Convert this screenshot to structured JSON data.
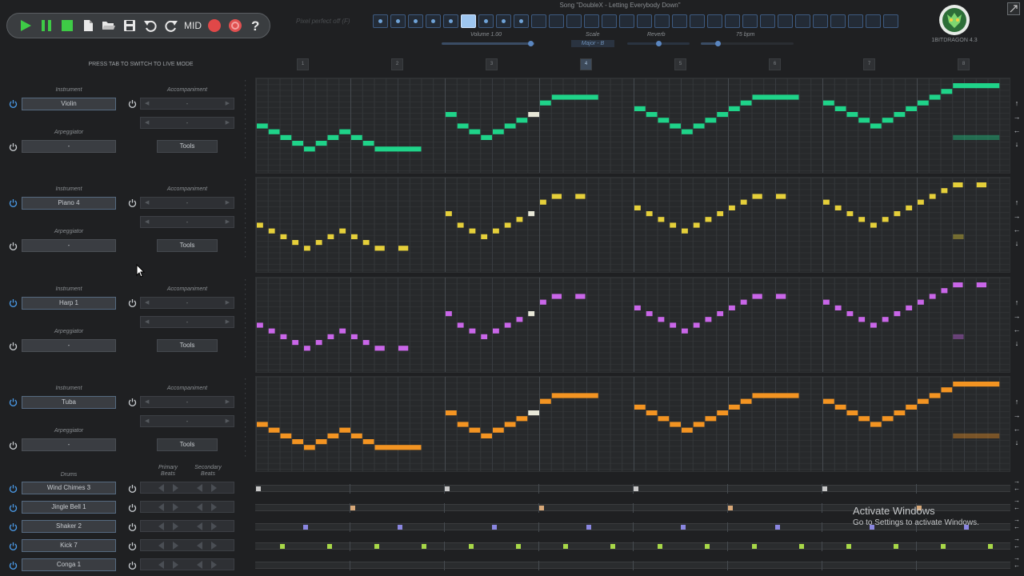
{
  "toolbar": {
    "buttons": [
      {
        "name": "play-button",
        "icon": "play-icon",
        "color": "#3ecb46"
      },
      {
        "name": "pause-button",
        "icon": "pause-icon",
        "color": "#3ecb46"
      },
      {
        "name": "stop-button",
        "icon": "stop-icon",
        "color": "#3ecb46"
      },
      {
        "name": "new-file-button",
        "icon": "new-file-icon",
        "color": "#e8e8e8"
      },
      {
        "name": "open-folder-button",
        "icon": "folder-open-icon",
        "color": "#e8e8e8"
      },
      {
        "name": "save-button",
        "icon": "save-icon",
        "color": "#e8e8e8"
      },
      {
        "name": "undo-button",
        "icon": "undo-icon",
        "color": "#e8e8e8"
      },
      {
        "name": "redo-button",
        "icon": "redo-icon",
        "color": "#e8e8e8"
      }
    ],
    "mid_label": "MID",
    "record_color": "#e04848",
    "loop_color": "#e05050"
  },
  "header": {
    "song_title": "Song \"DoubleX - Letting Everybody Down\"",
    "hint": "Pixel perfect off (F)",
    "volume_label": "Volume 1.00",
    "scale_label": "Scale",
    "scale_value": "Major - B",
    "reverb_label": "Reverb",
    "bpm_label": "75 bpm",
    "version": "1BITDRAGON 4.3",
    "live_hint": "PRESS TAB TO SWITCH TO LIVE MODE"
  },
  "patterns": {
    "filled": [
      true,
      true,
      true,
      true,
      true,
      "sel",
      true,
      true,
      true,
      false,
      false,
      false,
      false,
      false,
      false,
      false,
      false,
      false,
      false,
      false,
      false,
      false,
      false,
      false,
      false,
      false,
      false,
      false,
      false,
      false
    ]
  },
  "bars": {
    "labels": [
      "1",
      "2",
      "3",
      "4",
      "5",
      "6",
      "7",
      "8"
    ],
    "current": "4"
  },
  "tracks": [
    {
      "instrument_label": "Instrument",
      "instrument": "Violin",
      "accompaniment_label": "Accompaniment",
      "acc1": "-",
      "acc2": "-",
      "arp_label": "Arpeggiator",
      "arp": "-",
      "tools": "Tools",
      "color": "#1fd389"
    },
    {
      "instrument_label": "Instrument",
      "instrument": "Piano 4",
      "accompaniment_label": "Accompaniment",
      "acc1": "-",
      "acc2": "-",
      "arp_label": "Arpeggiator",
      "arp": "-",
      "tools": "Tools",
      "color": "#e5cf3a"
    },
    {
      "instrument_label": "Instrument",
      "instrument": "Harp 1",
      "accompaniment_label": "Accompaniment",
      "acc1": "-",
      "acc2": "-",
      "arp_label": "Arpeggiator",
      "arp": "-",
      "tools": "Tools",
      "color": "#c966e8"
    },
    {
      "instrument_label": "Instrument",
      "instrument": "Tuba",
      "accompaniment_label": "Accompaniment",
      "acc1": "-",
      "acc2": "-",
      "arp_label": "Arpeggiator",
      "arp": "-",
      "tools": "Tools",
      "color": "#f39422"
    }
  ],
  "drums": {
    "label": "Drums",
    "primary_label": "Primary Beats",
    "secondary_label": "Secondary Beats",
    "rows": [
      {
        "name": "Wind Chimes 3",
        "color": "#c8c8c8",
        "steps": [
          0,
          16,
          32,
          48
        ]
      },
      {
        "name": "Jingle Bell 1",
        "color": "#d8a878",
        "steps": [
          8,
          24,
          40,
          56
        ]
      },
      {
        "name": "Shaker 2",
        "color": "#8a86e0",
        "steps": [
          4,
          12,
          20,
          28,
          36,
          44,
          52,
          60
        ]
      },
      {
        "name": "Kick 7",
        "color": "#a8d848",
        "steps": [
          2,
          6,
          10,
          14,
          18,
          22,
          26,
          30,
          34,
          38,
          42,
          46,
          50,
          54,
          58,
          62
        ]
      },
      {
        "name": "Conga 1",
        "color": "#c8a040",
        "steps": []
      }
    ]
  },
  "watermark": {
    "title": "Activate Windows",
    "subtitle": "Go to Settings to activate Windows."
  }
}
